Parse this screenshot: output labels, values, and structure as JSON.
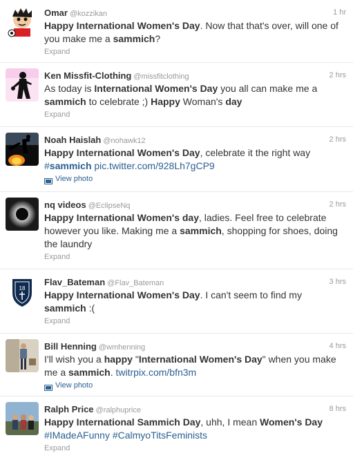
{
  "tweets": [
    {
      "name": "Omar",
      "handle": "@kozzikan",
      "time": "1 hr",
      "avatar_icon": "cartoon-boy-avatar",
      "text_parts": [
        {
          "t": "Happy International Women's Day",
          "b": true
        },
        {
          "t": ". Now that that's over, will one of you make me a "
        },
        {
          "t": "sammich",
          "b": true
        },
        {
          "t": "?"
        }
      ],
      "action": "Expand",
      "action_type": "expand"
    },
    {
      "name": "Ken Missfit-Clothing",
      "handle": "@missfitclothing",
      "time": "2 hrs",
      "avatar_icon": "silhouette-woman-avatar",
      "text_parts": [
        {
          "t": "As today is "
        },
        {
          "t": "International Women's Day",
          "b": true
        },
        {
          "t": " you all can make me a "
        },
        {
          "t": "sammich",
          "b": true
        },
        {
          "t": " to celebrate ;) "
        },
        {
          "t": "Happy",
          "b": true
        },
        {
          "t": " Woman's "
        },
        {
          "t": "day",
          "b": true
        }
      ],
      "action": "Expand",
      "action_type": "expand"
    },
    {
      "name": "Noah Haislah",
      "handle": "@nohawk12",
      "time": "2 hrs",
      "avatar_icon": "fire-silhouette-avatar",
      "text_parts": [
        {
          "t": "Happy International Women's Day",
          "b": true
        },
        {
          "t": ", celebrate it the right way "
        },
        {
          "t": "#",
          "h": true
        },
        {
          "t": "sammich",
          "h": true,
          "b": true
        },
        {
          "t": " "
        },
        {
          "t": "pic.twitter.com/928Lh7gCP9",
          "l": true
        }
      ],
      "action": "View photo",
      "action_type": "photo"
    },
    {
      "name": "nq videos",
      "handle": "@EclipseNq",
      "time": "2 hrs",
      "avatar_icon": "eclipse-avatar",
      "text_parts": [
        {
          "t": "Happy International Women's day",
          "b": true
        },
        {
          "t": ", ladies. Feel free to celebrate however you like. Making me a "
        },
        {
          "t": "sammich",
          "b": true
        },
        {
          "t": ", shopping for shoes, doing the laundry"
        }
      ],
      "action": "Expand",
      "action_type": "expand"
    },
    {
      "name": "Flav_Bateman",
      "handle": "@Flav_Bateman",
      "time": "3 hrs",
      "avatar_icon": "shield-crest-avatar",
      "text_parts": [
        {
          "t": "Happy International Women's Day",
          "b": true
        },
        {
          "t": ". I can't seem to find my "
        },
        {
          "t": "sammich",
          "b": true
        },
        {
          "t": " :("
        }
      ],
      "action": "Expand",
      "action_type": "expand"
    },
    {
      "name": "Bill Henning",
      "handle": "@wmhenning",
      "time": "4 hrs",
      "avatar_icon": "man-standing-avatar",
      "text_parts": [
        {
          "t": "I'll wish you a "
        },
        {
          "t": "happy",
          "b": true
        },
        {
          "t": " \""
        },
        {
          "t": "International Women's Day",
          "b": true
        },
        {
          "t": "\" when you make me a "
        },
        {
          "t": "sammich",
          "b": true
        },
        {
          "t": ". "
        },
        {
          "t": "twitrpix.com/bfn3m",
          "l": true
        }
      ],
      "action": "View photo",
      "action_type": "photo"
    },
    {
      "name": "Ralph Price",
      "handle": "@ralphuprice",
      "time": "8 hrs",
      "avatar_icon": "group-photo-avatar",
      "text_parts": [
        {
          "t": "Happy International Sammich Day",
          "b": true
        },
        {
          "t": ", uhh, I mean "
        },
        {
          "t": "Women's Day",
          "b": true
        },
        {
          "t": " "
        },
        {
          "t": "#IMadeAFunny",
          "h": true
        },
        {
          "t": " "
        },
        {
          "t": "#CalmyoTitsFeminists",
          "h": true
        }
      ],
      "action": "Expand",
      "action_type": "expand"
    }
  ],
  "colors": {
    "text": "#333333",
    "muted": "#999999",
    "link": "#2a5f91",
    "divider": "#e8e8e8"
  }
}
